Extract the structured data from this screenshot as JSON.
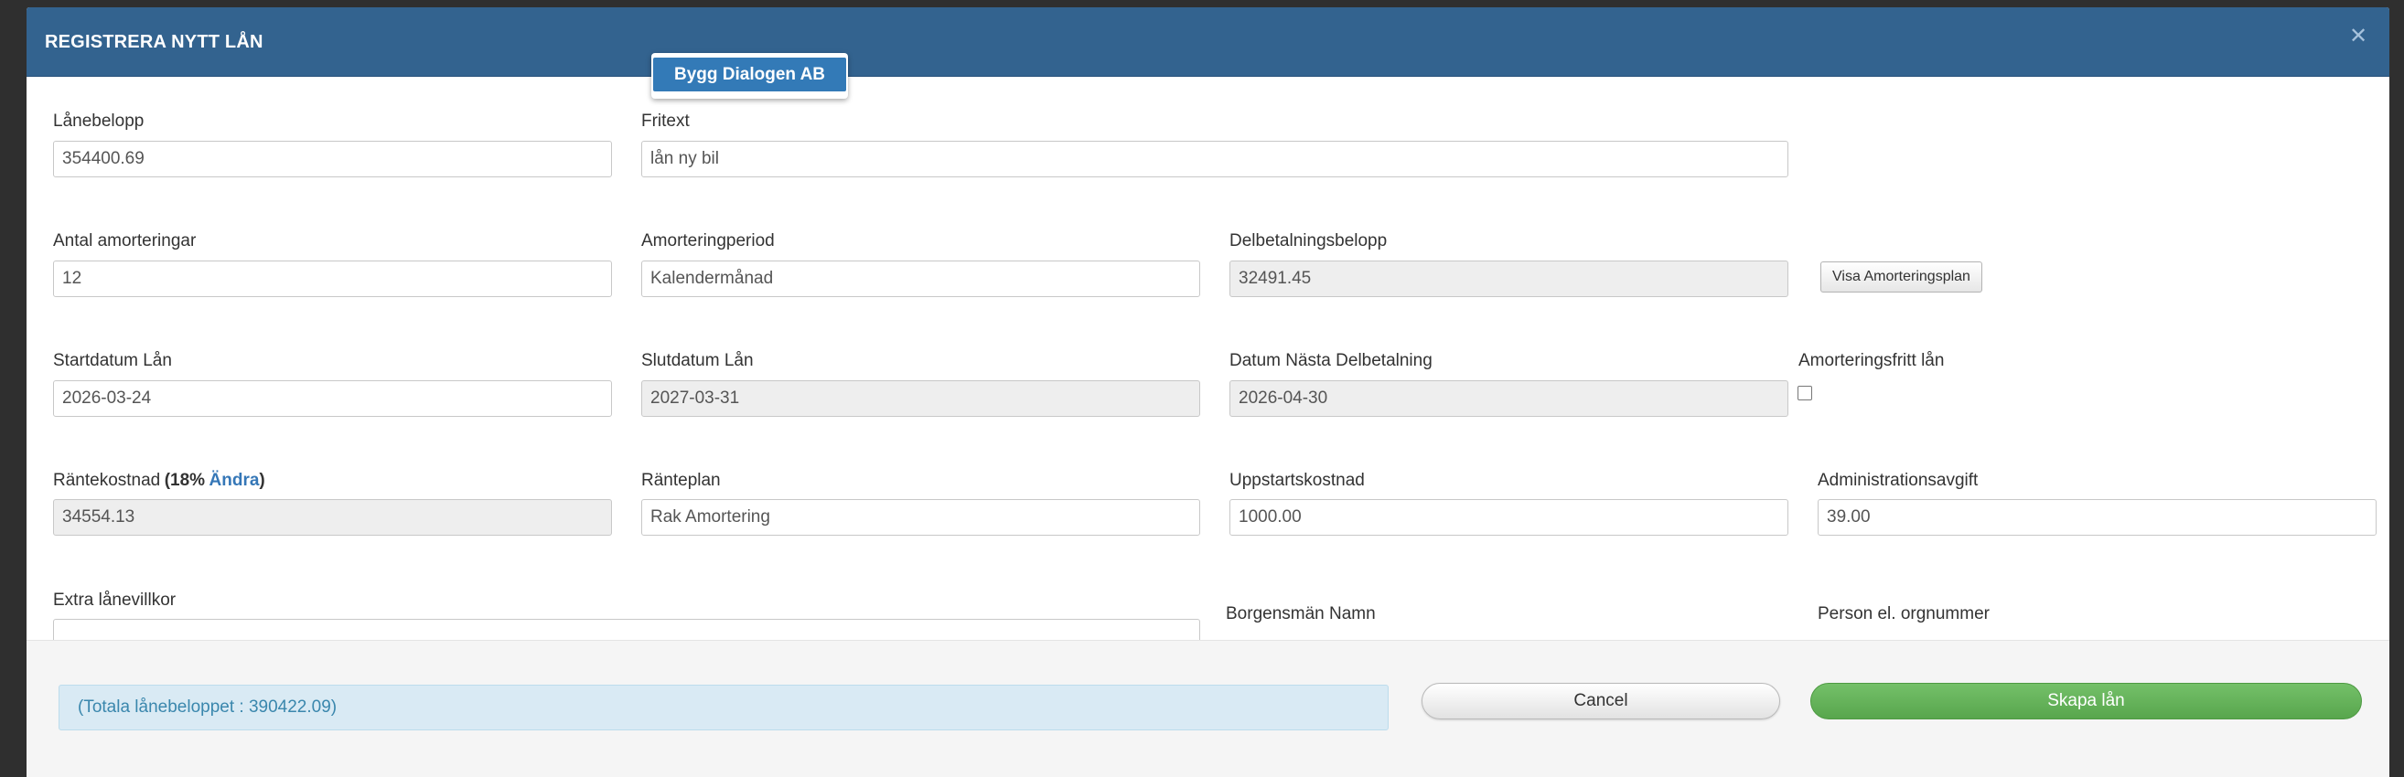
{
  "header": {
    "title": "REGISTRERA NYTT LÅN",
    "close_icon": "close-icon"
  },
  "company_popup": {
    "label": "Bygg Dialogen AB"
  },
  "form": {
    "lanebelopp": {
      "label": "Lånebelopp",
      "value": "354400.69"
    },
    "fritext": {
      "label": "Fritext",
      "value": "lån ny bil"
    },
    "antal_amorteringar": {
      "label": "Antal amorteringar",
      "value": "12"
    },
    "amorteringperiod": {
      "label": "Amorteringperiod",
      "value": "Kalendermånad"
    },
    "delbetalningsbelopp": {
      "label": "Delbetalningsbelopp",
      "value": "32491.45"
    },
    "visa_amorteringsplan": {
      "label": "Visa Amorteringsplan"
    },
    "startdatum": {
      "label": "Startdatum Lån",
      "value": "2026-03-24"
    },
    "slutdatum": {
      "label": "Slutdatum Lån",
      "value": "2027-03-31"
    },
    "datum_nasta": {
      "label": "Datum Nästa Delbetalning",
      "value": "2026-04-30"
    },
    "amorteringsfritt": {
      "label": "Amorteringsfritt lån",
      "checked": false
    },
    "rantekostnad": {
      "label": "Räntekostnad",
      "rate": "(18%",
      "change_link": "Ändra",
      "close_paren": ")",
      "value": "34554.13"
    },
    "ranteplan": {
      "label": "Ränteplan",
      "value": "Rak Amortering"
    },
    "uppstartskostnad": {
      "label": "Uppstartskostnad",
      "value": "1000.00"
    },
    "administrationsavgift": {
      "label": "Administrationsavgift",
      "value": "39.00"
    },
    "extra_lanevillkor": {
      "label": "Extra lånevillkor",
      "value": ""
    },
    "borgensman_namn": {
      "label": "Borgensmän Namn"
    },
    "person_orgnummer": {
      "label": "Person el. orgnummer"
    }
  },
  "footer": {
    "total_text": "(Totala lånebeloppet : 390422.09)",
    "cancel_label": "Cancel",
    "create_label": "Skapa lån"
  },
  "colors": {
    "header": "#33638f",
    "create_button": "#5cb85c",
    "info_box": "#d9eaf4",
    "link": "#3577b7"
  }
}
